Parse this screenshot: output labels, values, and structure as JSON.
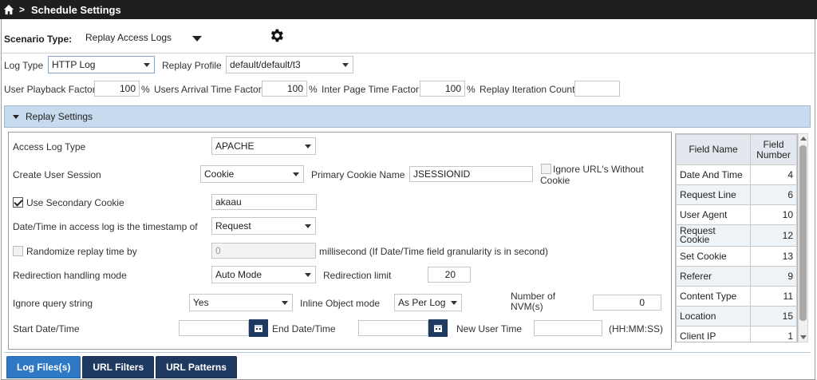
{
  "header": {
    "title": "Schedule Settings"
  },
  "scenario": {
    "label": "Scenario Type:",
    "value": "Replay Access Logs"
  },
  "row1": {
    "log_type_label": "Log Type",
    "log_type_value": "HTTP Log",
    "replay_profile_label": "Replay Profile",
    "replay_profile_value": "default/default/t3"
  },
  "row2": {
    "user_playback_label": "User Playback Factor",
    "user_playback_value": "100",
    "users_arrival_label": "Users Arrival Time Factor",
    "users_arrival_value": "100",
    "inter_page_label": "Inter Page Time Factor",
    "inter_page_value": "100",
    "replay_iteration_label": "Replay Iteration Count",
    "replay_iteration_value": "",
    "percent": "%"
  },
  "section": {
    "title": "Replay Settings"
  },
  "form": {
    "access_log_type_label": "Access Log Type",
    "access_log_type_value": "APACHE",
    "create_user_session_label": "Create User Session",
    "create_user_session_value": "Cookie",
    "primary_cookie_label": "Primary Cookie Name",
    "primary_cookie_value": "JSESSIONID",
    "ignore_urls_label": "Ignore URL's Without Cookie",
    "use_secondary_label": "Use Secondary Cookie",
    "secondary_cookie_value": "akaau",
    "datetime_label": "Date/Time in access log is the timestamp of",
    "datetime_value": "Request",
    "randomize_label": "Randomize replay time by",
    "randomize_value": "0",
    "millisecond_note": "millisecond (If Date/Time field granularity is in second)",
    "redirection_mode_label": "Redirection handling mode",
    "redirection_mode_value": "Auto Mode",
    "redirection_limit_label": "Redirection limit",
    "redirection_limit_value": "20",
    "ignore_query_label": "Ignore query string",
    "ignore_query_value": "Yes",
    "inline_object_label": "Inline Object mode",
    "inline_object_value": "As Per Log",
    "nvm_label": "Number of NVM(s)",
    "nvm_value": "0",
    "start_date_label": "Start Date/Time",
    "start_date_value": "",
    "end_date_label": "End Date/Time",
    "end_date_value": "",
    "new_user_time_label": "New User Time",
    "new_user_time_value": "",
    "time_format": "(HH:MM:SS)"
  },
  "field_table": {
    "headers": [
      "Field Name",
      "Field Number"
    ],
    "rows": [
      [
        "Date And Time",
        "4"
      ],
      [
        "Request Line",
        "6"
      ],
      [
        "User Agent",
        "10"
      ],
      [
        "Request Cookie",
        "12"
      ],
      [
        "Set Cookie",
        "13"
      ],
      [
        "Referer",
        "9"
      ],
      [
        "Content Type",
        "11"
      ],
      [
        "Location",
        "15"
      ],
      [
        "Client IP",
        "1"
      ]
    ]
  },
  "tabs": [
    "Log Files(s)",
    "URL Filters",
    "URL Patterns"
  ],
  "colors": {
    "header_bg": "#1d1f21",
    "section_bg": "#c8dbee",
    "tab_active": "#2e78c4",
    "tab": "#1f3a60"
  }
}
